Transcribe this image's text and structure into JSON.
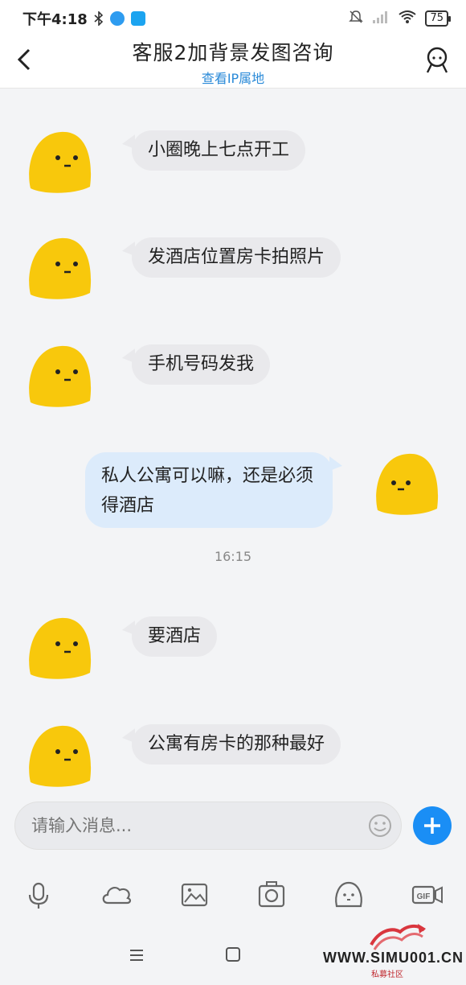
{
  "status_bar": {
    "time": "下午4:18",
    "battery": "75",
    "icons": [
      "bluetooth-icon",
      "app-icon",
      "app-icon",
      "mute-icon",
      "signal-icon",
      "wifi-icon"
    ]
  },
  "header": {
    "title": "客服2加背景发图咨询",
    "subtitle": "查看IP属地"
  },
  "messages": [
    {
      "side": "left",
      "text": "小圈晚上七点开工"
    },
    {
      "side": "left",
      "text": "发酒店位置房卡拍照片"
    },
    {
      "side": "left",
      "text": "手机号码发我"
    },
    {
      "side": "right",
      "text": "私人公寓可以嘛，还是必须得酒店"
    },
    {
      "side": "left",
      "text": "要酒店"
    },
    {
      "side": "left",
      "text": "公寓有房卡的那种最好"
    }
  ],
  "timestamp": "16:15",
  "input": {
    "placeholder": "请输入消息..."
  },
  "toolbar": [
    "microphone-icon",
    "cloud-icon",
    "image-icon",
    "camera-icon",
    "emoji-icon",
    "gif-icon"
  ],
  "watermark": {
    "text": "WWW.SIMU001.CN",
    "sub": "私募社区"
  },
  "colors": {
    "accent": "#1a8ef5",
    "link": "#2a8ad8",
    "bubble_other": "#e9e9ec",
    "bubble_self": "#dcebfb",
    "avatar": "#f8c80c"
  }
}
